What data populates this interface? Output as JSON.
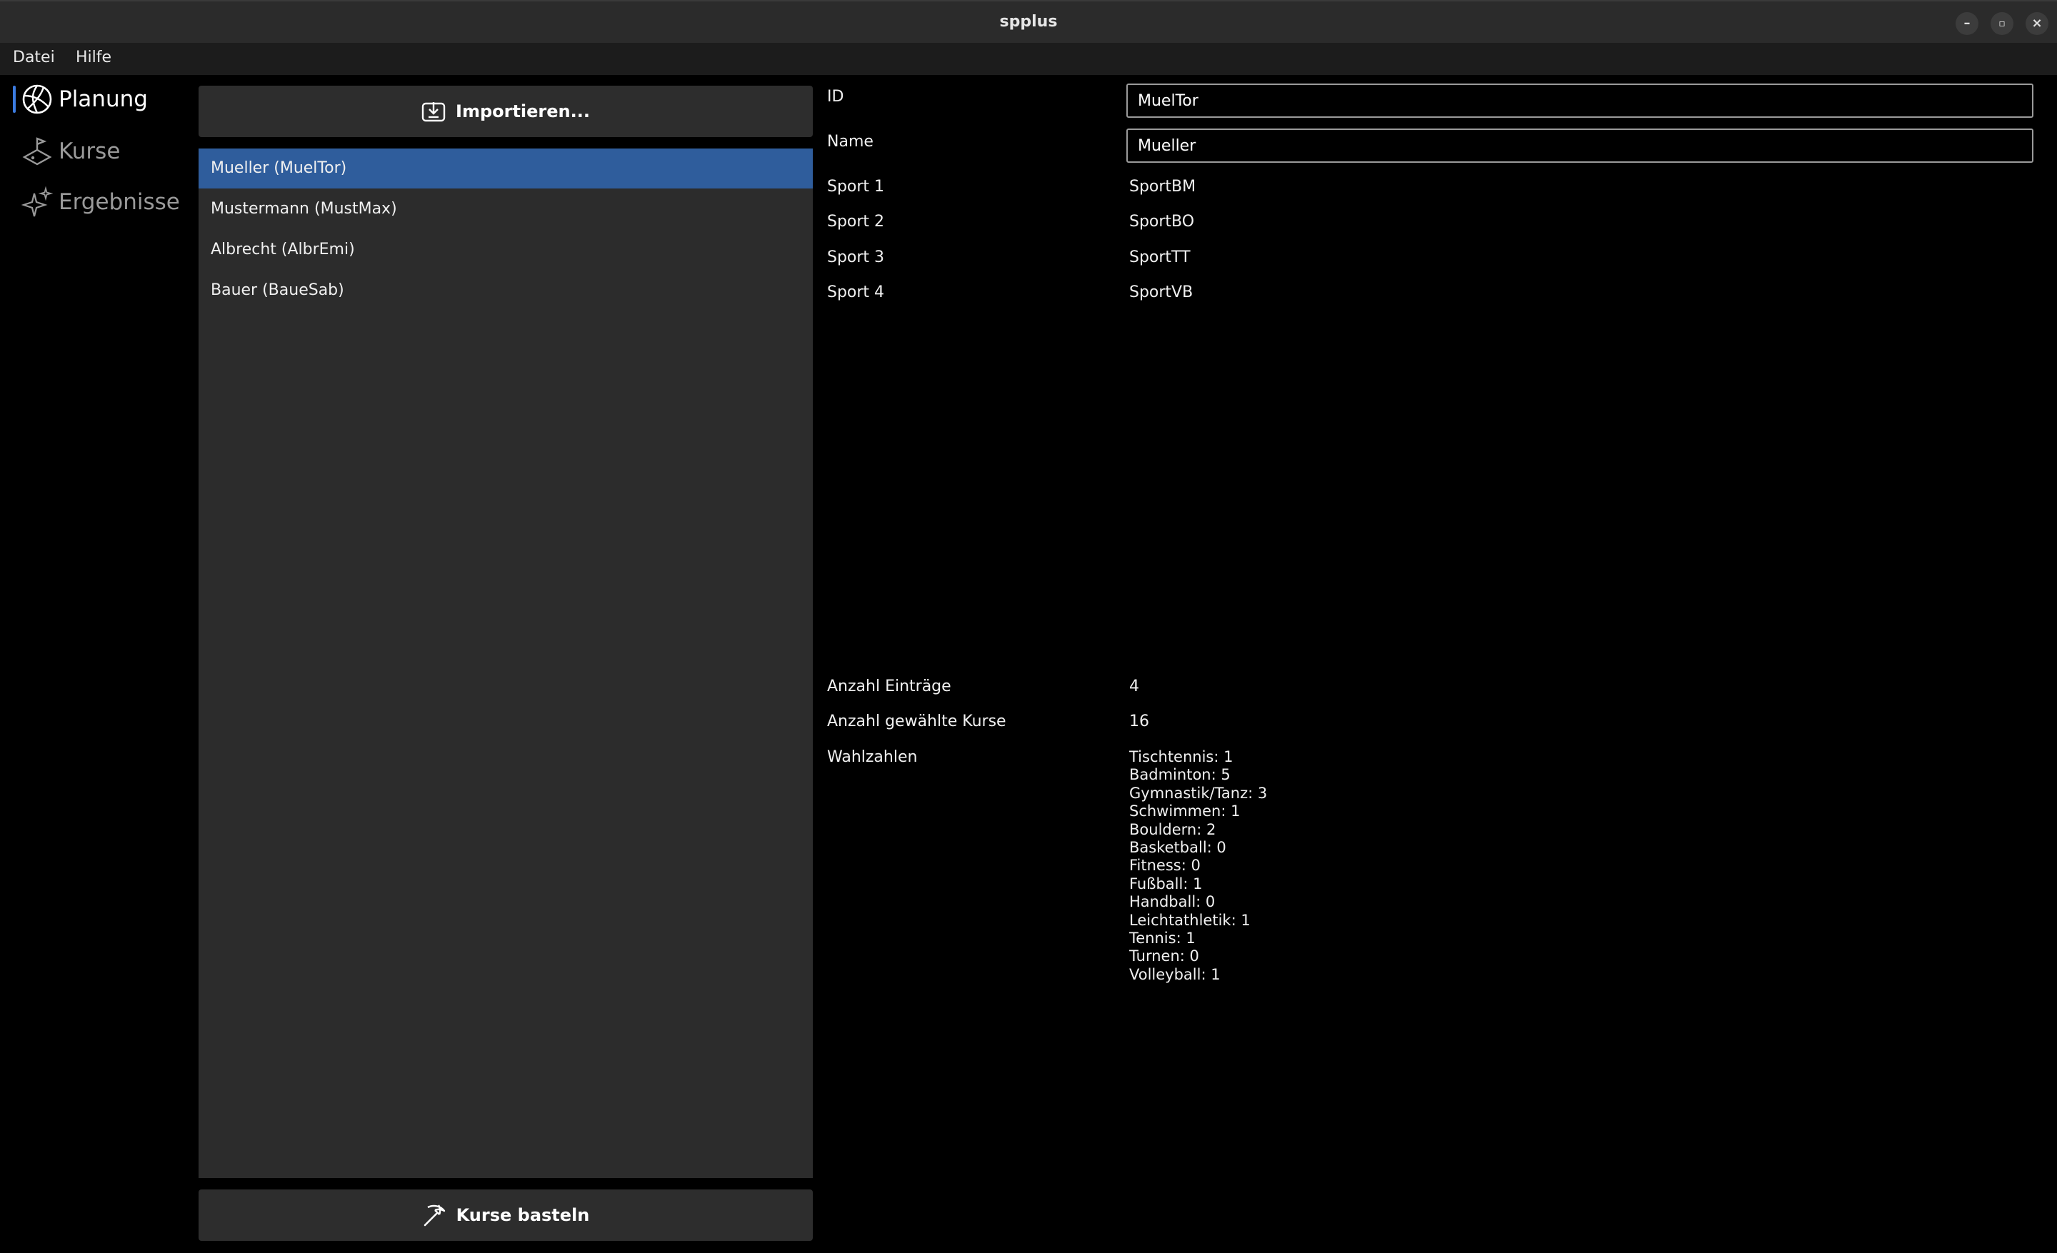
{
  "window": {
    "title": "spplus"
  },
  "menubar": {
    "items": [
      {
        "label": "Datei"
      },
      {
        "label": "Hilfe"
      }
    ]
  },
  "sidebar": {
    "items": [
      {
        "label": "Planung",
        "icon": "volleyball-icon",
        "active": true
      },
      {
        "label": "Kurse",
        "icon": "field-icon",
        "active": false
      },
      {
        "label": "Ergebnisse",
        "icon": "sparkles-icon",
        "active": false
      }
    ]
  },
  "toolbar": {
    "import_label": "Importieren...",
    "build_label": "Kurse basteln"
  },
  "students": [
    {
      "label": "Mueller (MuelTor)",
      "selected": true
    },
    {
      "label": "Mustermann (MustMax)",
      "selected": false
    },
    {
      "label": "Albrecht (AlbrEmi)",
      "selected": false
    },
    {
      "label": "Bauer (BaueSab)",
      "selected": false
    }
  ],
  "details": {
    "id_label": "ID",
    "id_value": "MuelTor",
    "name_label": "Name",
    "name_value": "Mueller",
    "sports": [
      {
        "label": "Sport 1",
        "value": "SportBM"
      },
      {
        "label": "Sport 2",
        "value": "SportBO"
      },
      {
        "label": "Sport 3",
        "value": "SportTT"
      },
      {
        "label": "Sport 4",
        "value": "SportVB"
      }
    ]
  },
  "summary": {
    "entries_label": "Anzahl Einträge",
    "entries_value": "4",
    "courses_label": "Anzahl gewählte Kurse",
    "courses_value": "16",
    "wahl_label": "Wahlzahlen",
    "wahlzahlen": [
      "Tischtennis: 1",
      "Badminton: 5",
      "Gymnastik/Tanz: 3",
      "Schwimmen: 1",
      "Bouldern: 2",
      "Basketball: 0",
      "Fitness: 0",
      "Fußball: 1",
      "Handball: 0",
      "Leichtathletik: 1",
      "Tennis: 1",
      "Turnen: 0",
      "Volleyball: 1"
    ]
  },
  "colors": {
    "accent": "#3b7be0",
    "selection": "#2f5d9c",
    "panel": "#2c2c2c"
  }
}
